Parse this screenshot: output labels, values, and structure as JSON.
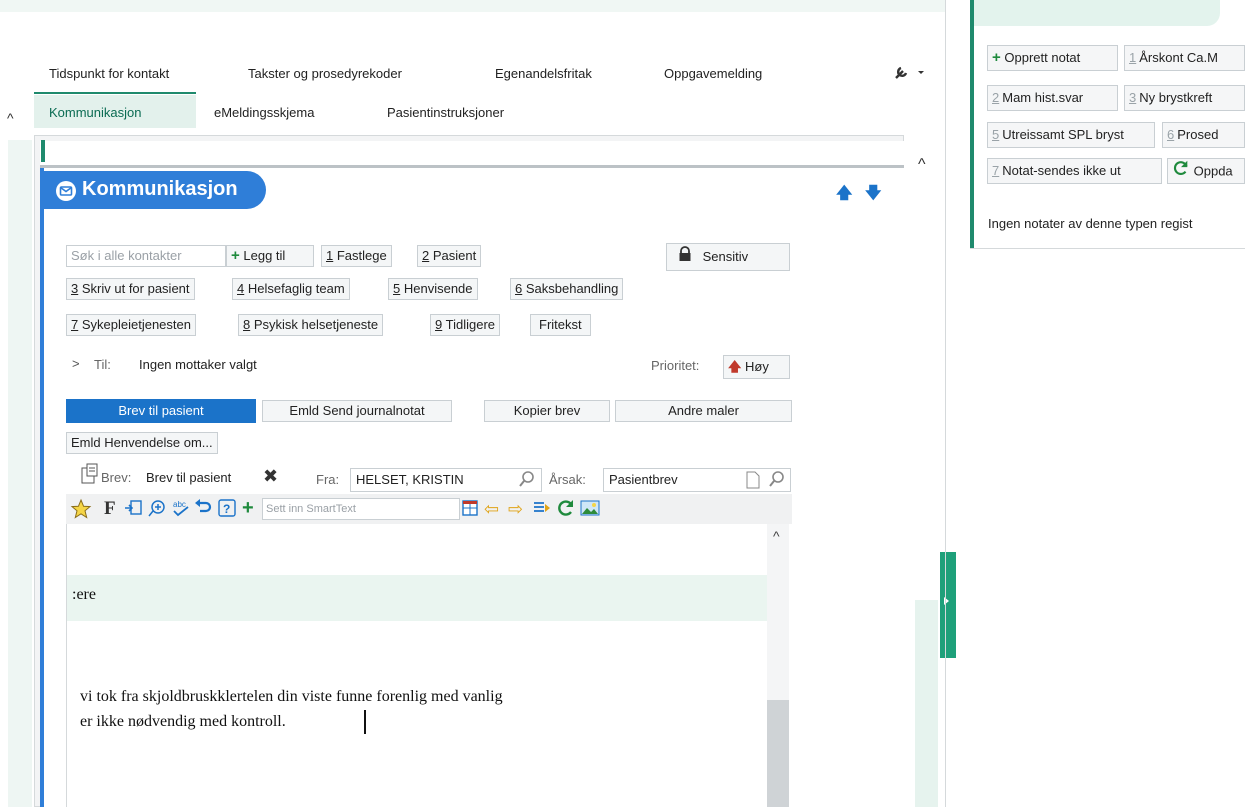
{
  "tabs_row1": [
    "Tidspunkt for kontakt",
    "Takster og prosedyrekoder",
    "Egenandelsfritak",
    "Oppgavemelding"
  ],
  "tabs_row2": [
    "Kommunikasjon",
    "eMeldingsskjema",
    "Pasientinstruksjoner"
  ],
  "panel": {
    "title": "Kommunikasjon",
    "search_placeholder": "Søk i alle kontakter",
    "add_label": "Legg til",
    "sensitive_label": "Sensitiv",
    "contacts": [
      {
        "n": "1",
        "label": "Fastlege"
      },
      {
        "n": "2",
        "label": "Pasient"
      },
      {
        "n": "3",
        "label": "Skriv ut for pasient"
      },
      {
        "n": "4",
        "label": "Helsefaglig team"
      },
      {
        "n": "5",
        "label": "Henvisende"
      },
      {
        "n": "6",
        "label": "Saksbehandling"
      },
      {
        "n": "7",
        "label": "Sykepleietjenesten"
      },
      {
        "n": "8",
        "label": "Psykisk helsetjeneste"
      },
      {
        "n": "9",
        "label": "Tidligere"
      }
    ],
    "fritekst": "Fritekst",
    "to_label": "Til:",
    "to_value": "Ingen mottaker valgt",
    "priority_label": "Prioritet:",
    "priority_value": "Høy",
    "templates": [
      "Brev til pasient",
      "Emld Send journalnotat",
      "Kopier brev",
      "Andre maler",
      "Emld Henvendelse om..."
    ],
    "letter_label": "Brev:",
    "letter_name": "Brev til pasient",
    "from_label": "Fra:",
    "from_value": "HELSET, KRISTIN",
    "reason_label": "Årsak:",
    "reason_value": "Pasientbrev",
    "smarttext_placeholder": "Sett inn SmartText",
    "toolbar_letter": "F",
    "editor_lines": [
      ":ere",
      "vi tok fra skjoldbruskklertelen din viste funne forenlig med vanlig",
      "er ikke nødvendig med kontroll."
    ]
  },
  "notes": {
    "buttons": [
      {
        "n": "",
        "label": "Opprett notat"
      },
      {
        "n": "1",
        "label": "Årskont Ca.M"
      },
      {
        "n": "2",
        "label": "Mam hist.svar"
      },
      {
        "n": "3",
        "label": "Ny brystkreft"
      },
      {
        "n": "5",
        "label": "Utreissamt SPL bryst"
      },
      {
        "n": "6",
        "label": "Prosed"
      },
      {
        "n": "7",
        "label": "Notat-sendes ikke ut"
      },
      {
        "n": "",
        "label": "Oppda"
      }
    ],
    "empty_text": "Ingen notater av denne typen regist"
  },
  "colors": {
    "accent": "#1f8a6d",
    "blue": "#1b73c9",
    "header_blue": "#2f7ed8"
  }
}
